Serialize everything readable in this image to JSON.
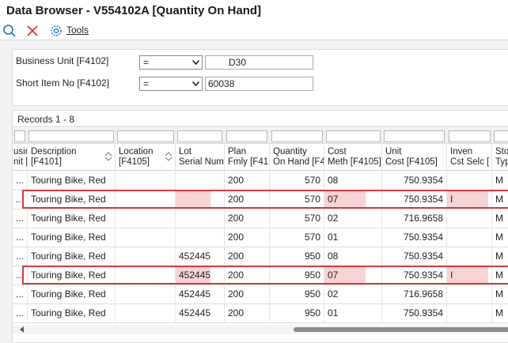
{
  "window": {
    "title": "Data Browser - V554102A [Quantity On Hand]"
  },
  "toolbar": {
    "search_icon": "search-icon",
    "close_icon": "close-icon",
    "tools_icon": "gear-icon",
    "tools_label": "Tools"
  },
  "filters": [
    {
      "label": "Business Unit [F4102]",
      "operator": "=",
      "value": "D30"
    },
    {
      "label": "Short Item No [F4102]",
      "operator": "=",
      "value": "60038"
    }
  ],
  "grid": {
    "records_label": "Records 1 - 8",
    "columns": [
      {
        "label_line1": "usin",
        "label_line2": "nit ["
      },
      {
        "label_line1": "Description",
        "label_line2": "[F4101]"
      },
      {
        "label_line1": "Location",
        "label_line2": "[F4105]"
      },
      {
        "label_line1": "Lot",
        "label_line2": "Serial Num"
      },
      {
        "label_line1": "Plan",
        "label_line2": "Fmly [F41"
      },
      {
        "label_line1": "Quantity",
        "label_line2": "On Hand [F4"
      },
      {
        "label_line1": "Cost",
        "label_line2": "Meth [F4105]"
      },
      {
        "label_line1": "Unit",
        "label_line2": "Cost [F4105]"
      },
      {
        "label_line1": "Inven",
        "label_line2": "Cst Selc ["
      },
      {
        "label_line1": "Sto",
        "label_line2": "Typ"
      }
    ],
    "rows": [
      {
        "bu": "...",
        "description": "Touring Bike, Red",
        "location": "",
        "lot": "",
        "plan": "200",
        "qty": "570",
        "cost_meth": "08",
        "unit_cost": "750.9354",
        "inv_cst": "",
        "stock": "M"
      },
      {
        "bu": "...",
        "description": "Touring Bike, Red",
        "location": "",
        "lot": "",
        "plan": "200",
        "qty": "570",
        "cost_meth": "07",
        "unit_cost": "750.9354",
        "inv_cst": "I",
        "stock": "M"
      },
      {
        "bu": "...",
        "description": "Touring Bike, Red",
        "location": "",
        "lot": "",
        "plan": "200",
        "qty": "570",
        "cost_meth": "02",
        "unit_cost": "716.9658",
        "inv_cst": "",
        "stock": "M"
      },
      {
        "bu": "...",
        "description": "Touring Bike, Red",
        "location": "",
        "lot": "",
        "plan": "200",
        "qty": "570",
        "cost_meth": "01",
        "unit_cost": "750.9354",
        "inv_cst": "",
        "stock": "M"
      },
      {
        "bu": "...",
        "description": "Touring Bike, Red",
        "location": "",
        "lot": "452445",
        "plan": "200",
        "qty": "950",
        "cost_meth": "08",
        "unit_cost": "750.9354",
        "inv_cst": "",
        "stock": "M"
      },
      {
        "bu": "...",
        "description": "Touring Bike, Red",
        "location": "",
        "lot": "452445",
        "plan": "200",
        "qty": "950",
        "cost_meth": "07",
        "unit_cost": "750.9354",
        "inv_cst": "I",
        "stock": "M"
      },
      {
        "bu": "...",
        "description": "Touring Bike, Red",
        "location": "",
        "lot": "452445",
        "plan": "200",
        "qty": "950",
        "cost_meth": "02",
        "unit_cost": "716.9658",
        "inv_cst": "",
        "stock": "M"
      },
      {
        "bu": "...",
        "description": "Touring Bike, Red",
        "location": "",
        "lot": "452445",
        "plan": "200",
        "qty": "950",
        "cost_meth": "01",
        "unit_cost": "750.9354",
        "inv_cst": "",
        "stock": "M"
      }
    ]
  },
  "colors": {
    "highlight_fill": "#f8d3d4",
    "highlight_outline": "#d23c3c",
    "icon_blue": "#1a73c8",
    "close_red": "#d9342b"
  }
}
